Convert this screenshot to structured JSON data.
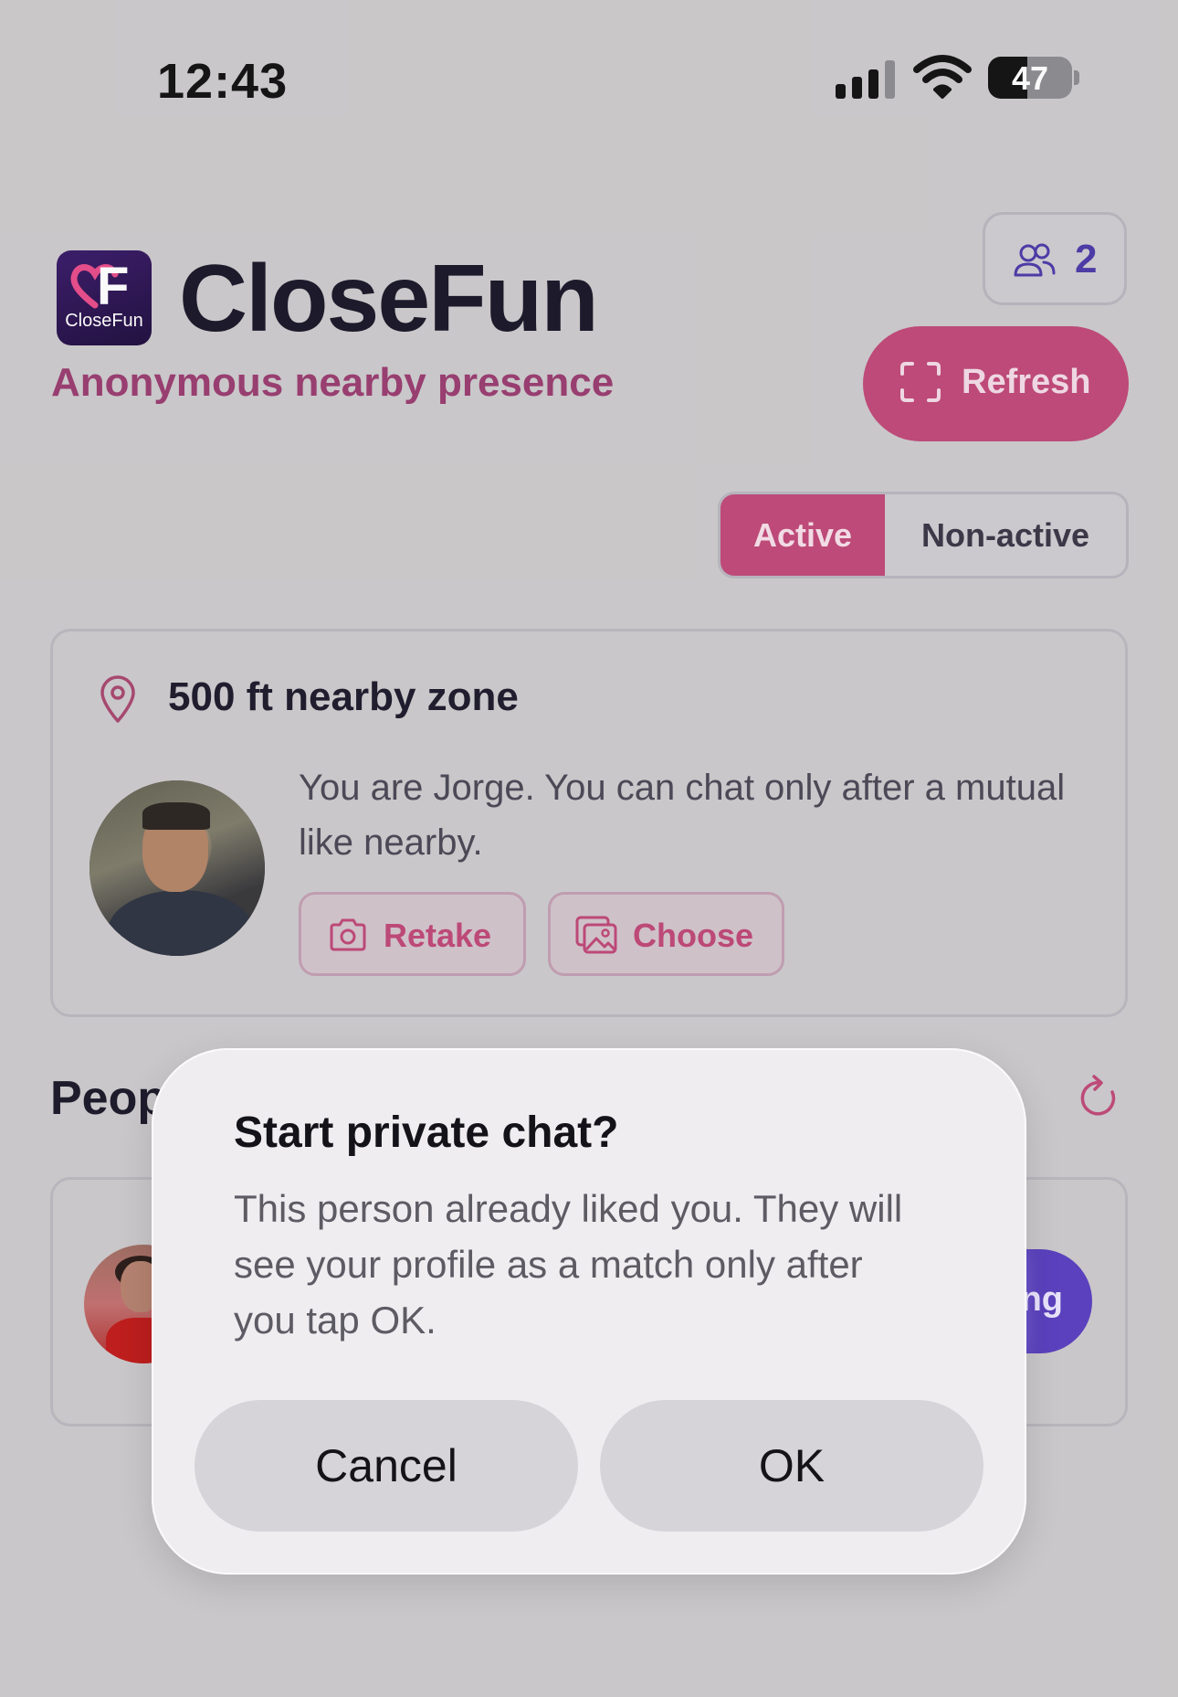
{
  "status_bar": {
    "time": "12:43",
    "battery": "47",
    "battery_level": 0.47
  },
  "header": {
    "logo_text": "CloseFun",
    "logo_letter": "F",
    "title": "CloseFun",
    "tagline": "Anonymous nearby presence",
    "people_count": "2",
    "refresh_label": "Refresh"
  },
  "toggle": {
    "active": "Active",
    "inactive": "Non-active",
    "selected": "Active"
  },
  "zone": {
    "title": "500 ft nearby zone",
    "description": "You are Jorge. You can chat only after a mutual like nearby.",
    "retake_label": "Retake",
    "choose_label": "Choose"
  },
  "people": {
    "title_visible": "Peop",
    "action_visible": "ng"
  },
  "alert": {
    "title": "Start private chat?",
    "message": "This person already liked you. They will see your profile as a match only after you tap OK.",
    "cancel_label": "Cancel",
    "ok_label": "OK"
  },
  "colors": {
    "accent_pink": "#c04878",
    "accent_purple": "#5a3fc0",
    "tagline": "#9a3c70",
    "background": "#cdcacc",
    "alert_bg": "#efedf0"
  }
}
